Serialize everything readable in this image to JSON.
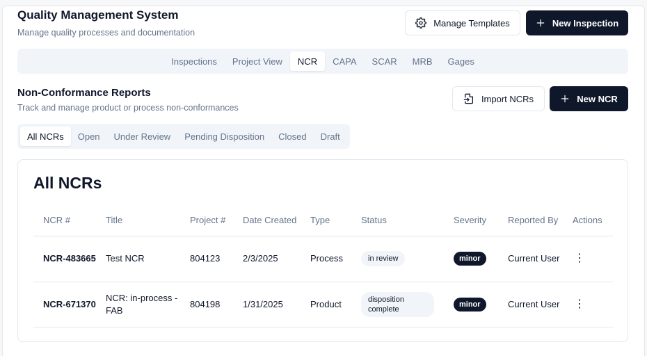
{
  "header": {
    "title": "Quality Management System",
    "subtitle": "Manage quality processes and documentation",
    "manage_templates_label": "Manage Templates",
    "new_inspection_label": "New Inspection"
  },
  "main_tabs": [
    {
      "label": "Inspections",
      "active": false
    },
    {
      "label": "Project View",
      "active": false
    },
    {
      "label": "NCR",
      "active": true
    },
    {
      "label": "CAPA",
      "active": false
    },
    {
      "label": "SCAR",
      "active": false
    },
    {
      "label": "MRB",
      "active": false
    },
    {
      "label": "Gages",
      "active": false
    }
  ],
  "section": {
    "title": "Non-Conformance Reports",
    "subtitle": "Track and manage product or process non-conformances",
    "import_label": "Import NCRs",
    "new_label": "New NCR"
  },
  "filter_tabs": [
    {
      "label": "All NCRs",
      "active": true
    },
    {
      "label": "Open",
      "active": false
    },
    {
      "label": "Under Review",
      "active": false
    },
    {
      "label": "Pending Disposition",
      "active": false
    },
    {
      "label": "Closed",
      "active": false
    },
    {
      "label": "Draft",
      "active": false
    }
  ],
  "table": {
    "title": "All NCRs",
    "columns": [
      "NCR #",
      "Title",
      "Project #",
      "Date Created",
      "Type",
      "Status",
      "Severity",
      "Reported By",
      "Actions"
    ],
    "rows": [
      {
        "ncr": "NCR-483665",
        "title": "Test NCR",
        "project": "804123",
        "date": "2/3/2025",
        "type": "Process",
        "status": "in review",
        "severity": "minor",
        "reported_by": "Current User"
      },
      {
        "ncr": "NCR-671370",
        "title": "NCR: in-process - FAB",
        "project": "804198",
        "date": "1/31/2025",
        "type": "Product",
        "status": "disposition complete",
        "severity": "minor",
        "reported_by": "Current User"
      }
    ]
  },
  "icons": {
    "manage_templates": "gear-icon",
    "new_inspection": "plus-icon",
    "import": "file-import-icon",
    "new_ncr": "plus-icon",
    "actions": "more-vertical-icon"
  },
  "colors": {
    "primary": "#0f172a",
    "muted_text": "#64748b",
    "tab_bg": "#f1f5f9",
    "border": "#e2e8f0"
  }
}
